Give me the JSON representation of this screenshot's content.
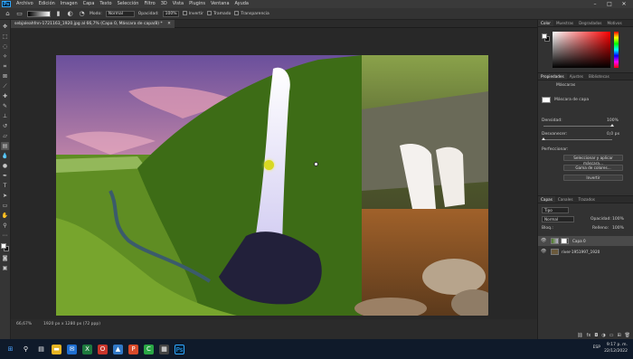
{
  "menubar": {
    "logo": "Ps",
    "items": [
      "Archivo",
      "Edición",
      "Imagen",
      "Capa",
      "Texto",
      "Selección",
      "Filtro",
      "3D",
      "Vista",
      "Plugins",
      "Ventana",
      "Ayuda"
    ],
    "minimize": "–",
    "maximize": "□",
    "close": "✕"
  },
  "options": {
    "mode_label": "Modo:",
    "mode_value": "Normal",
    "opacity_label": "Opacidad:",
    "opacity_value": "100%",
    "invert_label": "Invertir",
    "dither_label": "Tramado",
    "transparency_label": "Transparencia"
  },
  "document": {
    "tab_title": "sebjaleahfnn-1721163_1920.jpg al 66,7% (Capa 0, Máscara de capa/8) *",
    "tab_close": "✕"
  },
  "status": {
    "zoom": "66,67%",
    "info": "1920 px x 1280 px (72 ppp)"
  },
  "color_panel": {
    "tabs": [
      "Color",
      "Muestras",
      "Degradados",
      "Motivos"
    ]
  },
  "properties_panel": {
    "tabs": [
      "Propiedades",
      "Ajustes",
      "Bibliotecas"
    ],
    "mask_type": "Máscaras",
    "mask_row_label": "Máscara de capa",
    "density_label": "Densidad:",
    "density_value": "100%",
    "feather_label": "Desvanecer:",
    "feather_value": "0,0 px",
    "refine_label": "Perfeccionar:",
    "btn_select_mask": "Seleccionar y aplicar máscara...",
    "btn_color_range": "Gama de colores...",
    "btn_invert": "Invertir"
  },
  "layers_panel": {
    "tabs": [
      "Capas",
      "Canales",
      "Trazados"
    ],
    "kind_label": "Tipo",
    "blend_value": "Normal",
    "opacity_label": "Opacidad:",
    "opacity_value": "100%",
    "lock_label": "Bloq.:",
    "fill_label": "Relleno:",
    "fill_value": "100%",
    "layers": [
      {
        "name": "Capa 0",
        "selected": true
      },
      {
        "name": "river-1951997_1920",
        "selected": false
      }
    ]
  },
  "taskbar": {
    "lang": "ESP",
    "time": "9:17 p. m.",
    "date": "22/12/2022"
  },
  "colors": {
    "accent": "#31a8ff",
    "cursor": "#d8d823"
  }
}
